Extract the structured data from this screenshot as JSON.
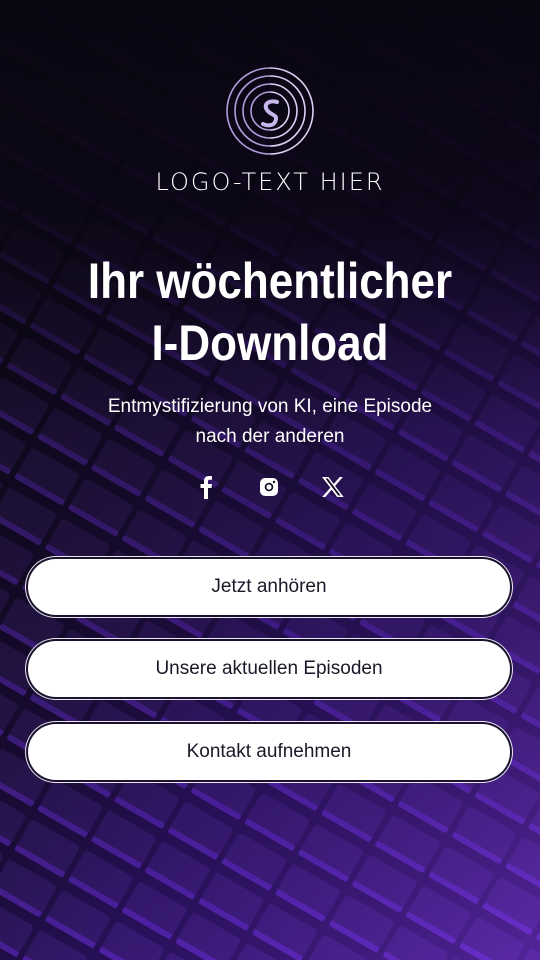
{
  "brand": {
    "logo_text": "LOGO-TEXT HIER",
    "logo_icon": "spiral-s-icon",
    "accent_color": "#b39ddb"
  },
  "hero": {
    "headline_line1": "Ihr wöchentlicher",
    "headline_line2": "I-Download",
    "subtitle_line1": "Entmystifizierung von KI, eine Episode",
    "subtitle_line2": "nach der anderen"
  },
  "socials": [
    {
      "name": "facebook",
      "icon": "facebook-icon"
    },
    {
      "name": "instagram",
      "icon": "instagram-icon"
    },
    {
      "name": "x",
      "icon": "x-icon"
    }
  ],
  "buttons": {
    "listen_now": "Jetzt anhören",
    "latest_episodes": "Unsere aktuellen Episoden",
    "contact": "Kontakt aufnehmen"
  },
  "colors": {
    "background": "#0b0614",
    "purple": "#7b2ff7",
    "button_bg": "#ffffff",
    "button_text": "#1c1828"
  }
}
